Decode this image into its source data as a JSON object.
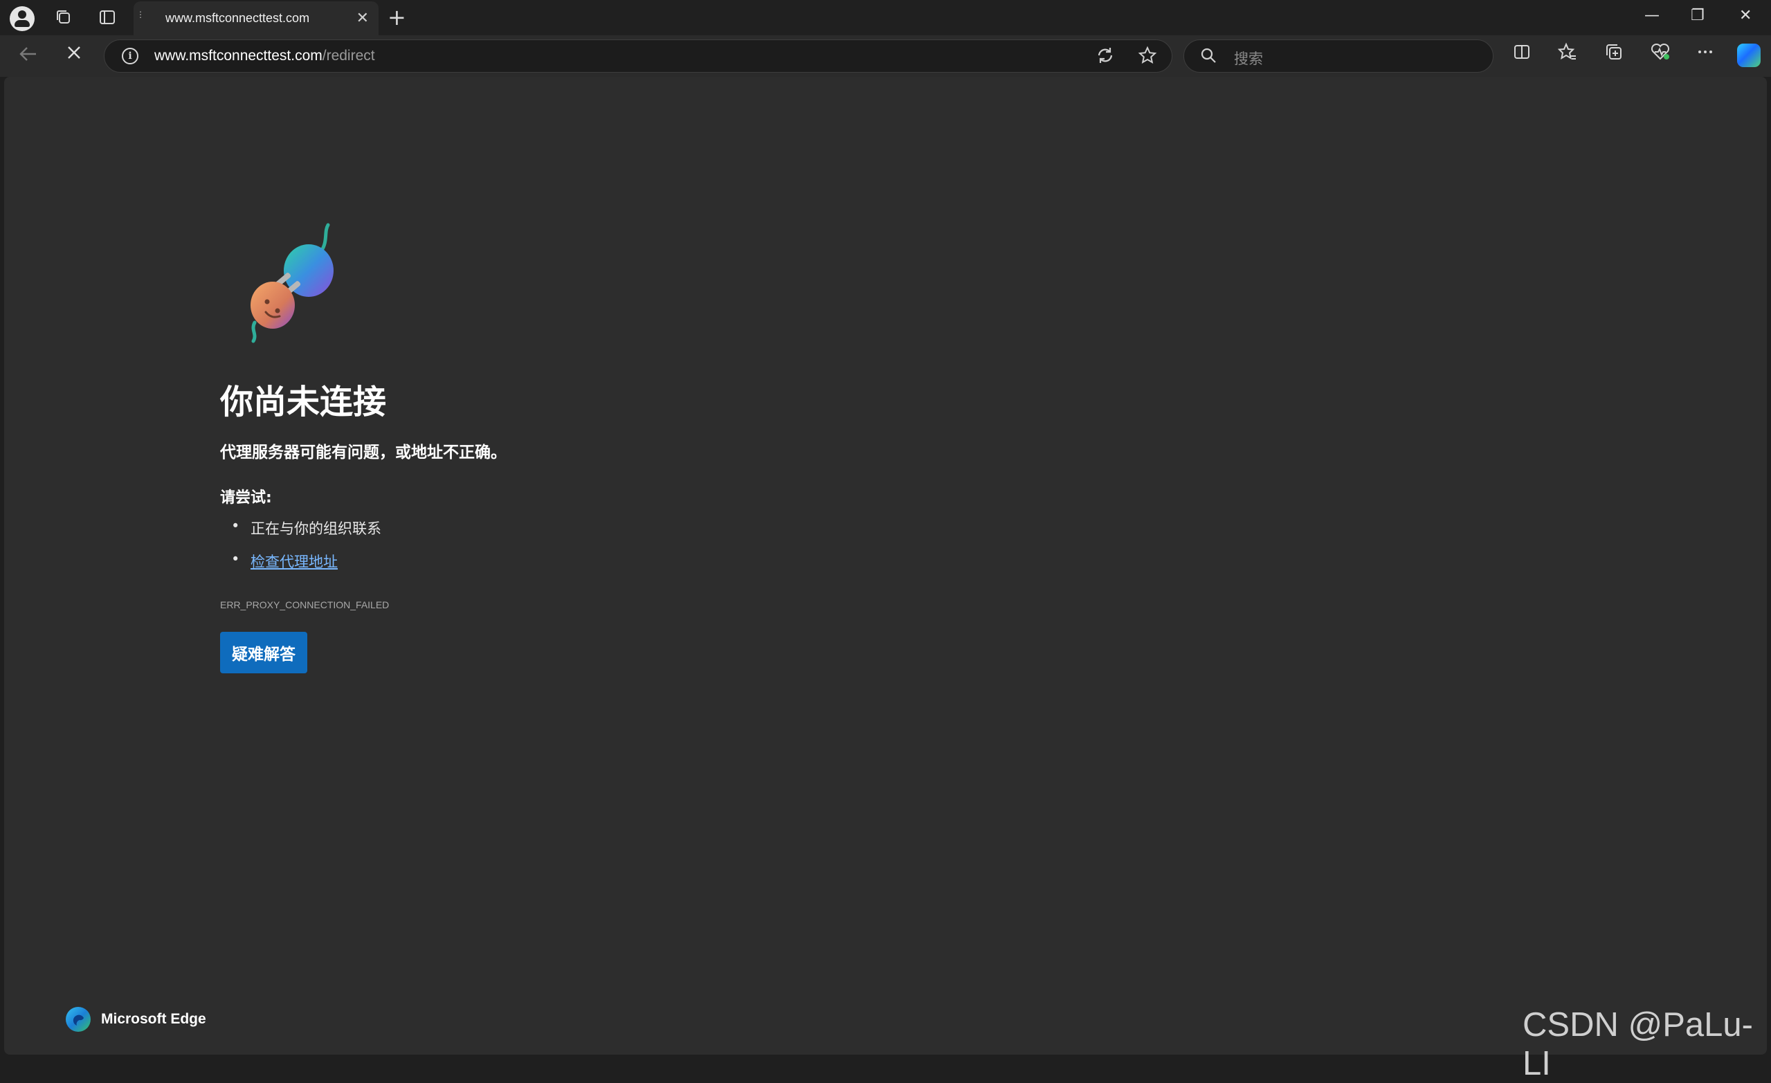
{
  "tab": {
    "title": "www.msftconnecttest.com",
    "close_glyph": "✕",
    "new_tab_glyph": "+"
  },
  "window_controls": {
    "minimize": "—",
    "restore": "❐",
    "close": "✕"
  },
  "address_bar": {
    "url_host": "www.msftconnecttest.com",
    "url_path": "/redirect"
  },
  "search": {
    "placeholder": "搜索"
  },
  "page": {
    "heading": "你尚未连接",
    "subheading": "代理服务器可能有问题，或地址不正确。",
    "try_label": "请尝试:",
    "suggestions": {
      "contact_org": "正在与你的组织联系",
      "check_proxy": "检查代理地址"
    },
    "error_code": "ERR_PROXY_CONNECTION_FAILED",
    "troubleshoot_button": "疑难解答"
  },
  "footer": {
    "brand": "Microsoft Edge"
  },
  "watermark": "CSDN @PaLu-LI",
  "colors": {
    "accent": "#0f6cbd",
    "link": "#79b8ff",
    "page_bg": "#2d2d2d",
    "chrome_bg": "#202020"
  }
}
